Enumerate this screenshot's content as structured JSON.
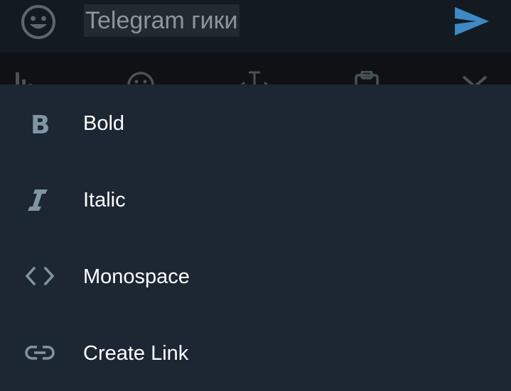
{
  "input_bar": {
    "message_text": "Telegram гики",
    "emoji_icon": "smile-icon",
    "send_icon": "send-icon",
    "accent_color": "#3d8ac4"
  },
  "toolbar": {
    "icons": [
      "chart-bars-icon",
      "smile-icon",
      "text-cursor-icon",
      "clipboard-icon",
      "close-icon"
    ]
  },
  "format_menu": {
    "items": [
      {
        "label": "Bold",
        "icon": "bold-icon"
      },
      {
        "label": "Italic",
        "icon": "italic-icon"
      },
      {
        "label": "Monospace",
        "icon": "code-icon"
      },
      {
        "label": "Create Link",
        "icon": "link-icon"
      }
    ],
    "icon_color": "#8195a3",
    "text_color": "#ffffff",
    "background": "#1d2733"
  }
}
